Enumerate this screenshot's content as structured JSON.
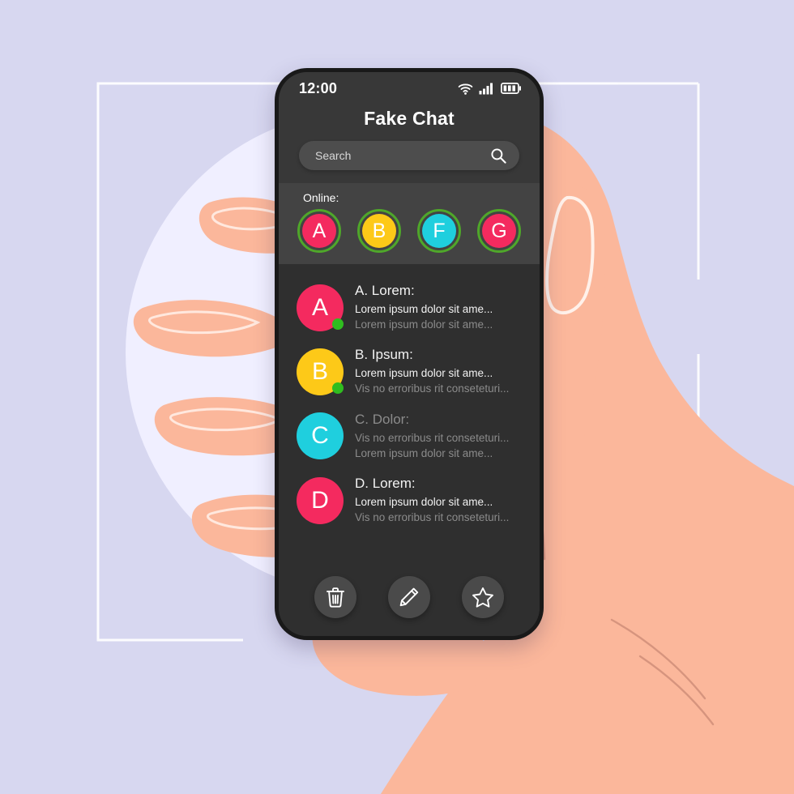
{
  "background": {
    "page_color": "#d7d7f0",
    "circle_color": "#f0efff",
    "outline_color": "#ffffff",
    "skin_color": "#fbb79b",
    "skin_shadow": "#f7a98c"
  },
  "phone": {
    "frame_color": "#191919",
    "screen_color": "#2f2f2f",
    "header_color": "#383838",
    "online_panel_color": "#434343"
  },
  "statusbar": {
    "time": "12:00",
    "icons": [
      "wifi-icon",
      "signal-icon",
      "battery-icon"
    ],
    "signal_bars": 4,
    "battery_segments": 3
  },
  "header": {
    "title": "Fake Chat",
    "search": {
      "placeholder": "Search",
      "value": "",
      "icon": "search-icon"
    }
  },
  "online": {
    "label": "Online:",
    "ring_color": "#4fa72a",
    "avatars": [
      {
        "letter": "A",
        "color": "#f42a5f"
      },
      {
        "letter": "B",
        "color": "#fdc918"
      },
      {
        "letter": "F",
        "color": "#1fcfde"
      },
      {
        "letter": "G",
        "color": "#f42a5f"
      }
    ]
  },
  "chats": [
    {
      "name": "A. Lorem:",
      "letter": "A",
      "color": "#f42a5f",
      "online": true,
      "name_bright": true,
      "line1": "Lorem ipsum dolor sit ame...",
      "line1_bright": true,
      "line2": "Lorem ipsum dolor sit ame...",
      "line2_bright": false
    },
    {
      "name": "B. Ipsum:",
      "letter": "B",
      "color": "#fdc918",
      "online": true,
      "name_bright": true,
      "line1": "Lorem ipsum dolor sit ame...",
      "line1_bright": true,
      "line2": "Vis no erroribus rit conseteturi...",
      "line2_bright": false
    },
    {
      "name": "C. Dolor:",
      "letter": "C",
      "color": "#1fcfde",
      "online": false,
      "name_bright": false,
      "line1": "Vis no erroribus rit conseteturi...",
      "line1_bright": false,
      "line2": "Lorem ipsum dolor sit ame...",
      "line2_bright": false
    },
    {
      "name": "D. Lorem:",
      "letter": "D",
      "color": "#f42a5f",
      "online": false,
      "name_bright": true,
      "line1": "Lorem ipsum dolor sit ame...",
      "line1_bright": true,
      "line2": "Vis no erroribus rit conseteturi...",
      "line2_bright": false
    }
  ],
  "toolbar": {
    "buttons": [
      {
        "name": "delete-button",
        "icon": "trash-icon"
      },
      {
        "name": "compose-button",
        "icon": "pencil-icon"
      },
      {
        "name": "favorite-button",
        "icon": "star-icon"
      }
    ]
  }
}
